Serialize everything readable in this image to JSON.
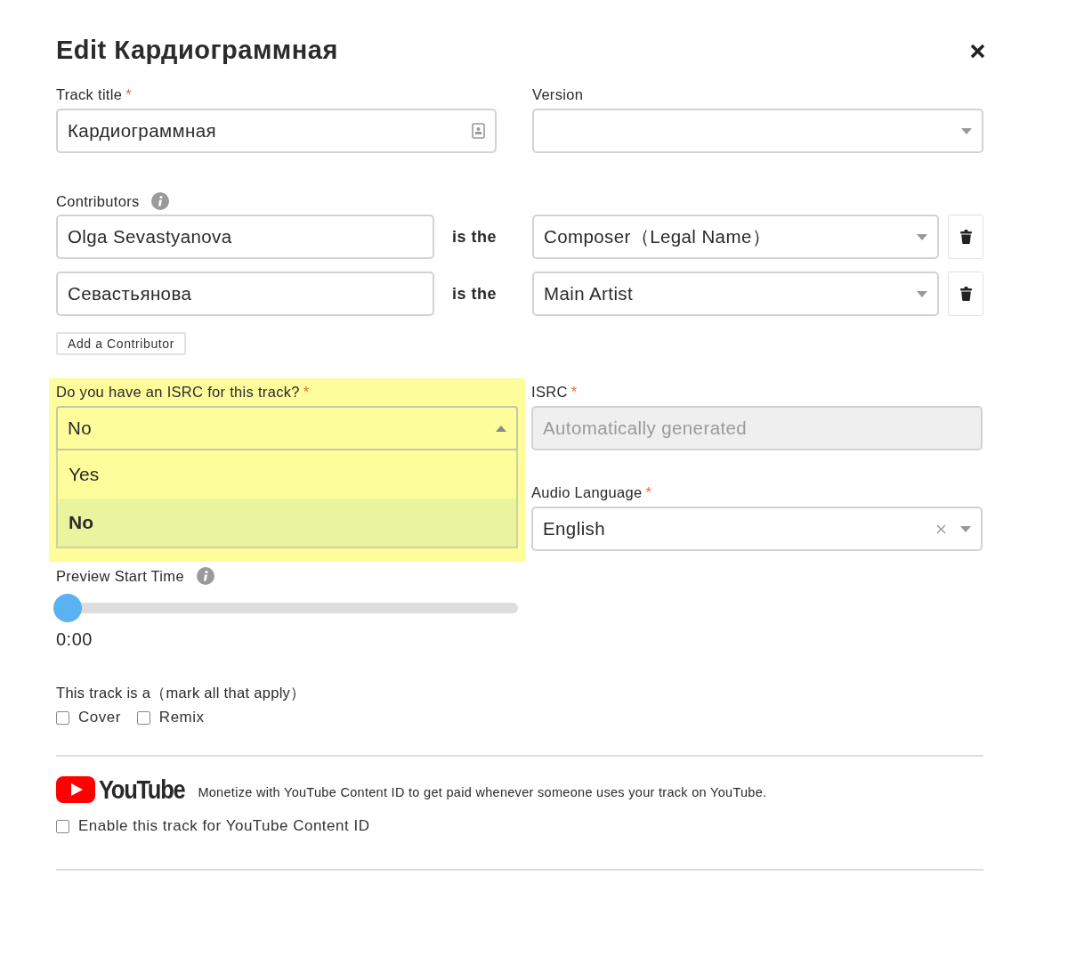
{
  "dialog": {
    "title": "Edit Кардиограммная"
  },
  "track_title": {
    "label": "Track title",
    "required_mark": "*",
    "value": "Кардиограммная"
  },
  "version": {
    "label": "Version"
  },
  "contributors": {
    "label": "Contributors",
    "rows": [
      {
        "name": "Olga Sevastyanova",
        "relation": "is the",
        "role": "Composer（Legal Name）"
      },
      {
        "name": "Севастьянова",
        "relation": "is the",
        "role": "Main Artist"
      }
    ],
    "add_button": "Add a Contributor"
  },
  "isrc_question": {
    "label": "Do you have an ISRC for this track?",
    "required_mark": "*",
    "value": "No",
    "expanded": true,
    "highlighted": true,
    "options": [
      {
        "label": "Yes",
        "selected": false
      },
      {
        "label": "No",
        "selected": true
      }
    ]
  },
  "isrc": {
    "label": "ISRC",
    "required_mark": "*",
    "placeholder": "Automatically generated",
    "disabled": true
  },
  "audio_language": {
    "label": "Audio Language",
    "required_mark": "*",
    "value": "English"
  },
  "preview": {
    "label": "Preview Start Time",
    "level": 0,
    "time": "0:00"
  },
  "track_type": {
    "label": "This track is a（mark all that apply）",
    "options": [
      {
        "label": "Cover",
        "checked": false
      },
      {
        "label": "Remix",
        "checked": false
      }
    ]
  },
  "youtube": {
    "logo_text": "YouTube",
    "description": "Monetize with YouTube Content ID to get paid whenever someone uses your track on YouTube.",
    "checkbox": {
      "label": "Enable this track for YouTube Content ID",
      "checked": false
    }
  }
}
